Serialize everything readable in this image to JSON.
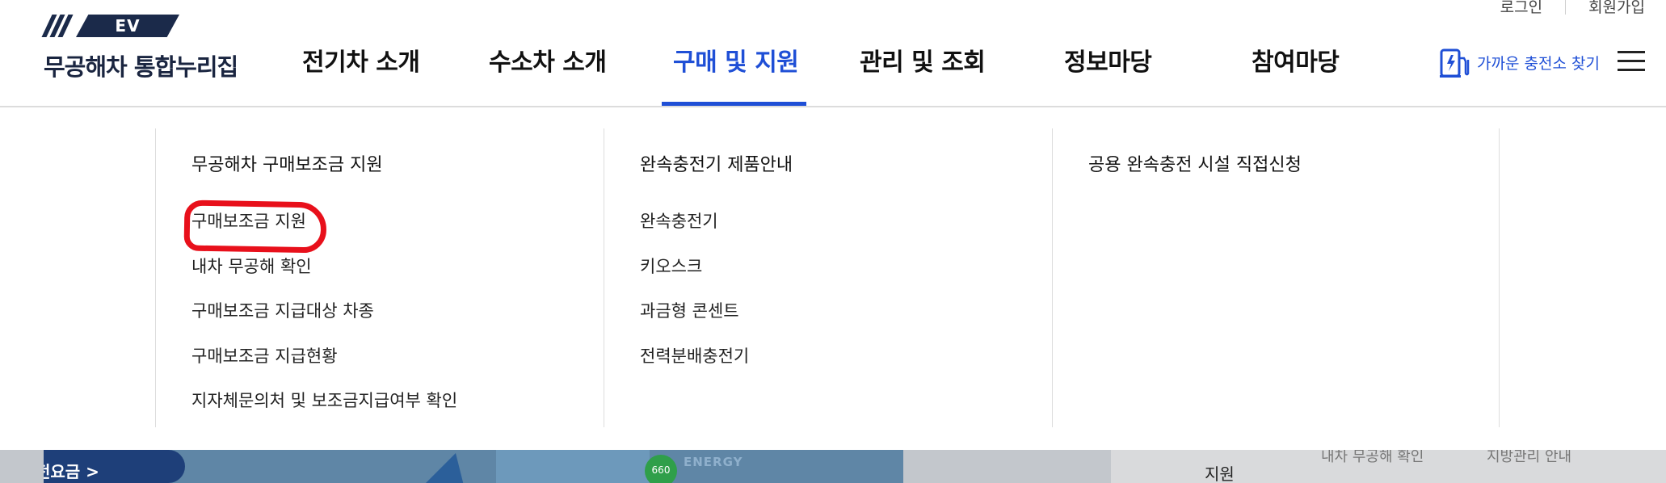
{
  "util": {
    "login": "로그인",
    "signup": "회원가입"
  },
  "logo": {
    "badge": "EV",
    "site_name": "무공해차 통합누리집"
  },
  "gnb": [
    {
      "label": "전기차 소개",
      "active": false
    },
    {
      "label": "수소차 소개",
      "active": false
    },
    {
      "label": "구매 및 지원",
      "active": true
    },
    {
      "label": "관리 및 조회",
      "active": false
    },
    {
      "label": "정보마당",
      "active": false
    },
    {
      "label": "참여마당",
      "active": false
    }
  ],
  "charger_link": {
    "label": "가까운 충전소 찾기",
    "icon": "charging-station-icon"
  },
  "menu_icon": "hamburger-menu-icon",
  "accent_color": "#1f4fd6",
  "highlight_color": "#e8101b",
  "mega_menu": {
    "columns": [
      {
        "title": "무공해차 구매보조금 지원",
        "links": [
          "구매보조금 지원",
          "내차 무공해 확인",
          "구매보조금 지급대상 차종",
          "구매보조금 지급현황",
          "지자체문의처 및 보조금지급여부 확인"
        ]
      },
      {
        "title": "완속충전기 제품안내",
        "links": [
          "완속충전기",
          "키오스크",
          "과금형 콘센트",
          "전력분배충전기"
        ]
      },
      {
        "title": "공용 완속충전 시설 직접신청",
        "links": []
      }
    ]
  },
  "background": {
    "banner_button": "전요금 >",
    "badge_text": "660",
    "banner_text": "ENERGY",
    "right_item": "지원",
    "right_partial_1": "내차 무공해 확인",
    "right_partial_2": "지방관리 안내"
  }
}
